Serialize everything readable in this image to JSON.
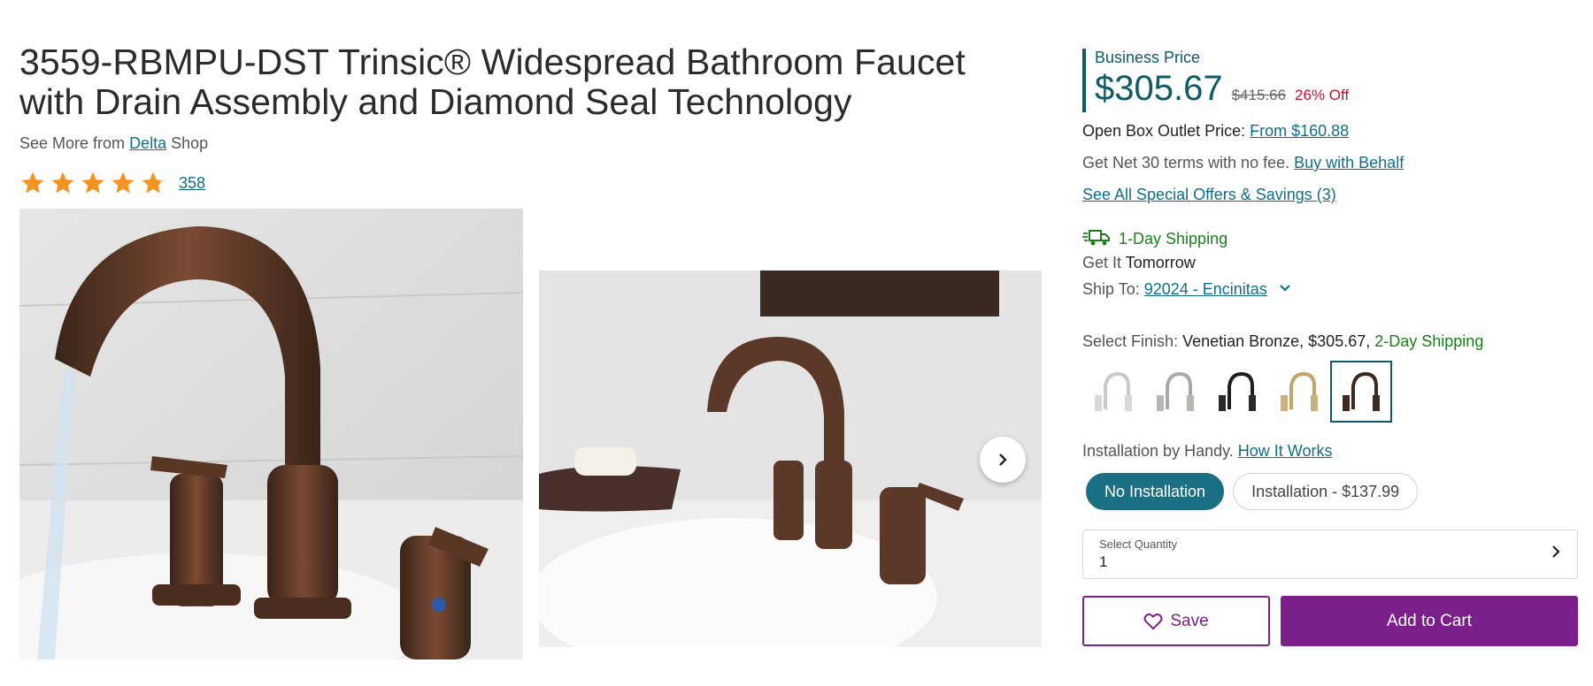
{
  "product": {
    "title": "3559-RBMPU-DST Trinsic® Widespread Bathroom Faucet with Drain Assembly and Diamond Seal Technology",
    "see_more_prefix": "See More from",
    "brand": "Delta",
    "see_more_suffix": "Shop",
    "rating_value": 4.8,
    "review_count": "358"
  },
  "pricing": {
    "label": "Business Price",
    "price": "$305.67",
    "old_price": "$415.66",
    "discount": "26% Off",
    "open_box_label": "Open Box Outlet Price:",
    "open_box_link": "From $160.88",
    "net30_text": "Get Net 30 terms with no fee.",
    "net30_link": "Buy with Behalf",
    "offers_link": "See All Special Offers & Savings (3)"
  },
  "shipping": {
    "badge": "1-Day Shipping",
    "get_it_label": "Get It",
    "get_it_value": "Tomorrow",
    "ship_to_label": "Ship To:",
    "ship_to_link": "92024 - Encinitas"
  },
  "finish": {
    "label": "Select Finish:",
    "selected": "Venetian Bronze, $305.67,",
    "shipping": "2-Day Shipping",
    "swatches": [
      "chrome",
      "brushed-nickel",
      "matte-black",
      "champagne-bronze",
      "venetian-bronze"
    ],
    "selected_index": 4
  },
  "installation": {
    "label": "Installation by Handy.",
    "link": "How It Works",
    "options": [
      "No Installation",
      "Installation - $137.99"
    ],
    "active_index": 0
  },
  "quantity": {
    "label": "Select Quantity",
    "value": "1"
  },
  "actions": {
    "save": "Save",
    "add_to_cart": "Add to Cart"
  },
  "colors": {
    "accent_teal": "#0e5a66",
    "purple": "#7b1f8a",
    "discount_red": "#c8102e",
    "shipping_green": "#1a7f1a",
    "star_orange": "#f5931f"
  }
}
